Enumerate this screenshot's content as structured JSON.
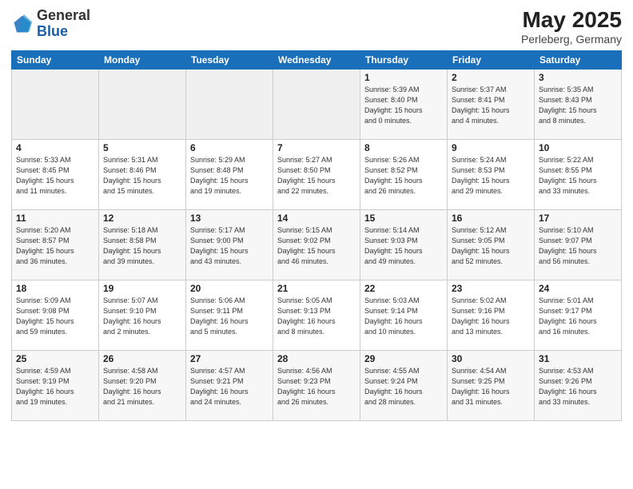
{
  "header": {
    "logo_general": "General",
    "logo_blue": "Blue",
    "month_year": "May 2025",
    "location": "Perleberg, Germany"
  },
  "days_of_week": [
    "Sunday",
    "Monday",
    "Tuesday",
    "Wednesday",
    "Thursday",
    "Friday",
    "Saturday"
  ],
  "weeks": [
    [
      {
        "day": "",
        "info": ""
      },
      {
        "day": "",
        "info": ""
      },
      {
        "day": "",
        "info": ""
      },
      {
        "day": "",
        "info": ""
      },
      {
        "day": "1",
        "info": "Sunrise: 5:39 AM\nSunset: 8:40 PM\nDaylight: 15 hours\nand 0 minutes."
      },
      {
        "day": "2",
        "info": "Sunrise: 5:37 AM\nSunset: 8:41 PM\nDaylight: 15 hours\nand 4 minutes."
      },
      {
        "day": "3",
        "info": "Sunrise: 5:35 AM\nSunset: 8:43 PM\nDaylight: 15 hours\nand 8 minutes."
      }
    ],
    [
      {
        "day": "4",
        "info": "Sunrise: 5:33 AM\nSunset: 8:45 PM\nDaylight: 15 hours\nand 11 minutes."
      },
      {
        "day": "5",
        "info": "Sunrise: 5:31 AM\nSunset: 8:46 PM\nDaylight: 15 hours\nand 15 minutes."
      },
      {
        "day": "6",
        "info": "Sunrise: 5:29 AM\nSunset: 8:48 PM\nDaylight: 15 hours\nand 19 minutes."
      },
      {
        "day": "7",
        "info": "Sunrise: 5:27 AM\nSunset: 8:50 PM\nDaylight: 15 hours\nand 22 minutes."
      },
      {
        "day": "8",
        "info": "Sunrise: 5:26 AM\nSunset: 8:52 PM\nDaylight: 15 hours\nand 26 minutes."
      },
      {
        "day": "9",
        "info": "Sunrise: 5:24 AM\nSunset: 8:53 PM\nDaylight: 15 hours\nand 29 minutes."
      },
      {
        "day": "10",
        "info": "Sunrise: 5:22 AM\nSunset: 8:55 PM\nDaylight: 15 hours\nand 33 minutes."
      }
    ],
    [
      {
        "day": "11",
        "info": "Sunrise: 5:20 AM\nSunset: 8:57 PM\nDaylight: 15 hours\nand 36 minutes."
      },
      {
        "day": "12",
        "info": "Sunrise: 5:18 AM\nSunset: 8:58 PM\nDaylight: 15 hours\nand 39 minutes."
      },
      {
        "day": "13",
        "info": "Sunrise: 5:17 AM\nSunset: 9:00 PM\nDaylight: 15 hours\nand 43 minutes."
      },
      {
        "day": "14",
        "info": "Sunrise: 5:15 AM\nSunset: 9:02 PM\nDaylight: 15 hours\nand 46 minutes."
      },
      {
        "day": "15",
        "info": "Sunrise: 5:14 AM\nSunset: 9:03 PM\nDaylight: 15 hours\nand 49 minutes."
      },
      {
        "day": "16",
        "info": "Sunrise: 5:12 AM\nSunset: 9:05 PM\nDaylight: 15 hours\nand 52 minutes."
      },
      {
        "day": "17",
        "info": "Sunrise: 5:10 AM\nSunset: 9:07 PM\nDaylight: 15 hours\nand 56 minutes."
      }
    ],
    [
      {
        "day": "18",
        "info": "Sunrise: 5:09 AM\nSunset: 9:08 PM\nDaylight: 15 hours\nand 59 minutes."
      },
      {
        "day": "19",
        "info": "Sunrise: 5:07 AM\nSunset: 9:10 PM\nDaylight: 16 hours\nand 2 minutes."
      },
      {
        "day": "20",
        "info": "Sunrise: 5:06 AM\nSunset: 9:11 PM\nDaylight: 16 hours\nand 5 minutes."
      },
      {
        "day": "21",
        "info": "Sunrise: 5:05 AM\nSunset: 9:13 PM\nDaylight: 16 hours\nand 8 minutes."
      },
      {
        "day": "22",
        "info": "Sunrise: 5:03 AM\nSunset: 9:14 PM\nDaylight: 16 hours\nand 10 minutes."
      },
      {
        "day": "23",
        "info": "Sunrise: 5:02 AM\nSunset: 9:16 PM\nDaylight: 16 hours\nand 13 minutes."
      },
      {
        "day": "24",
        "info": "Sunrise: 5:01 AM\nSunset: 9:17 PM\nDaylight: 16 hours\nand 16 minutes."
      }
    ],
    [
      {
        "day": "25",
        "info": "Sunrise: 4:59 AM\nSunset: 9:19 PM\nDaylight: 16 hours\nand 19 minutes."
      },
      {
        "day": "26",
        "info": "Sunrise: 4:58 AM\nSunset: 9:20 PM\nDaylight: 16 hours\nand 21 minutes."
      },
      {
        "day": "27",
        "info": "Sunrise: 4:57 AM\nSunset: 9:21 PM\nDaylight: 16 hours\nand 24 minutes."
      },
      {
        "day": "28",
        "info": "Sunrise: 4:56 AM\nSunset: 9:23 PM\nDaylight: 16 hours\nand 26 minutes."
      },
      {
        "day": "29",
        "info": "Sunrise: 4:55 AM\nSunset: 9:24 PM\nDaylight: 16 hours\nand 28 minutes."
      },
      {
        "day": "30",
        "info": "Sunrise: 4:54 AM\nSunset: 9:25 PM\nDaylight: 16 hours\nand 31 minutes."
      },
      {
        "day": "31",
        "info": "Sunrise: 4:53 AM\nSunset: 9:26 PM\nDaylight: 16 hours\nand 33 minutes."
      }
    ]
  ]
}
